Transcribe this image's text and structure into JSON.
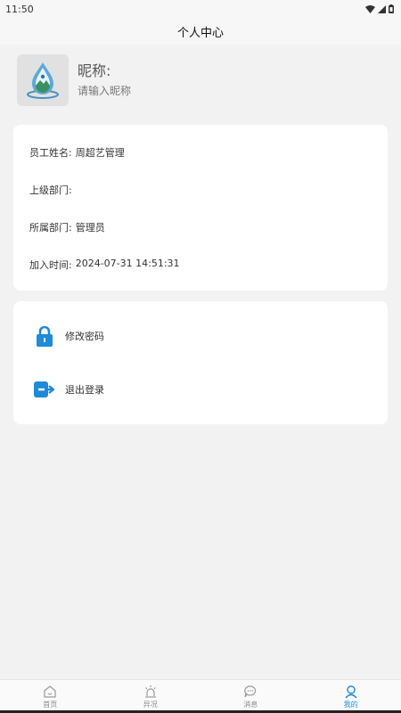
{
  "status": {
    "time": "11:50"
  },
  "header": {
    "title": "个人中心"
  },
  "profile": {
    "nickname_label": "昵称:",
    "nickname_placeholder": "请输入昵称"
  },
  "info": [
    {
      "label": "员工姓名:",
      "value": "周超艺管理"
    },
    {
      "label": "上级部门:",
      "value": ""
    },
    {
      "label": "所属部门:",
      "value": "管理员"
    },
    {
      "label": "加入时间:",
      "value": "2024-07-31 14:51:31"
    }
  ],
  "actions": [
    {
      "label": "修改密码",
      "icon": "lock-icon"
    },
    {
      "label": "退出登录",
      "icon": "logout-icon"
    }
  ],
  "tabs": [
    {
      "label": "首页",
      "icon": "home-icon"
    },
    {
      "label": "异况",
      "icon": "alarm-icon"
    },
    {
      "label": "消息",
      "icon": "chat-icon"
    },
    {
      "label": "我的",
      "icon": "user-icon",
      "active": true
    }
  ],
  "colors": {
    "accent": "#1f8ad8",
    "background": "#f2f2f2"
  }
}
